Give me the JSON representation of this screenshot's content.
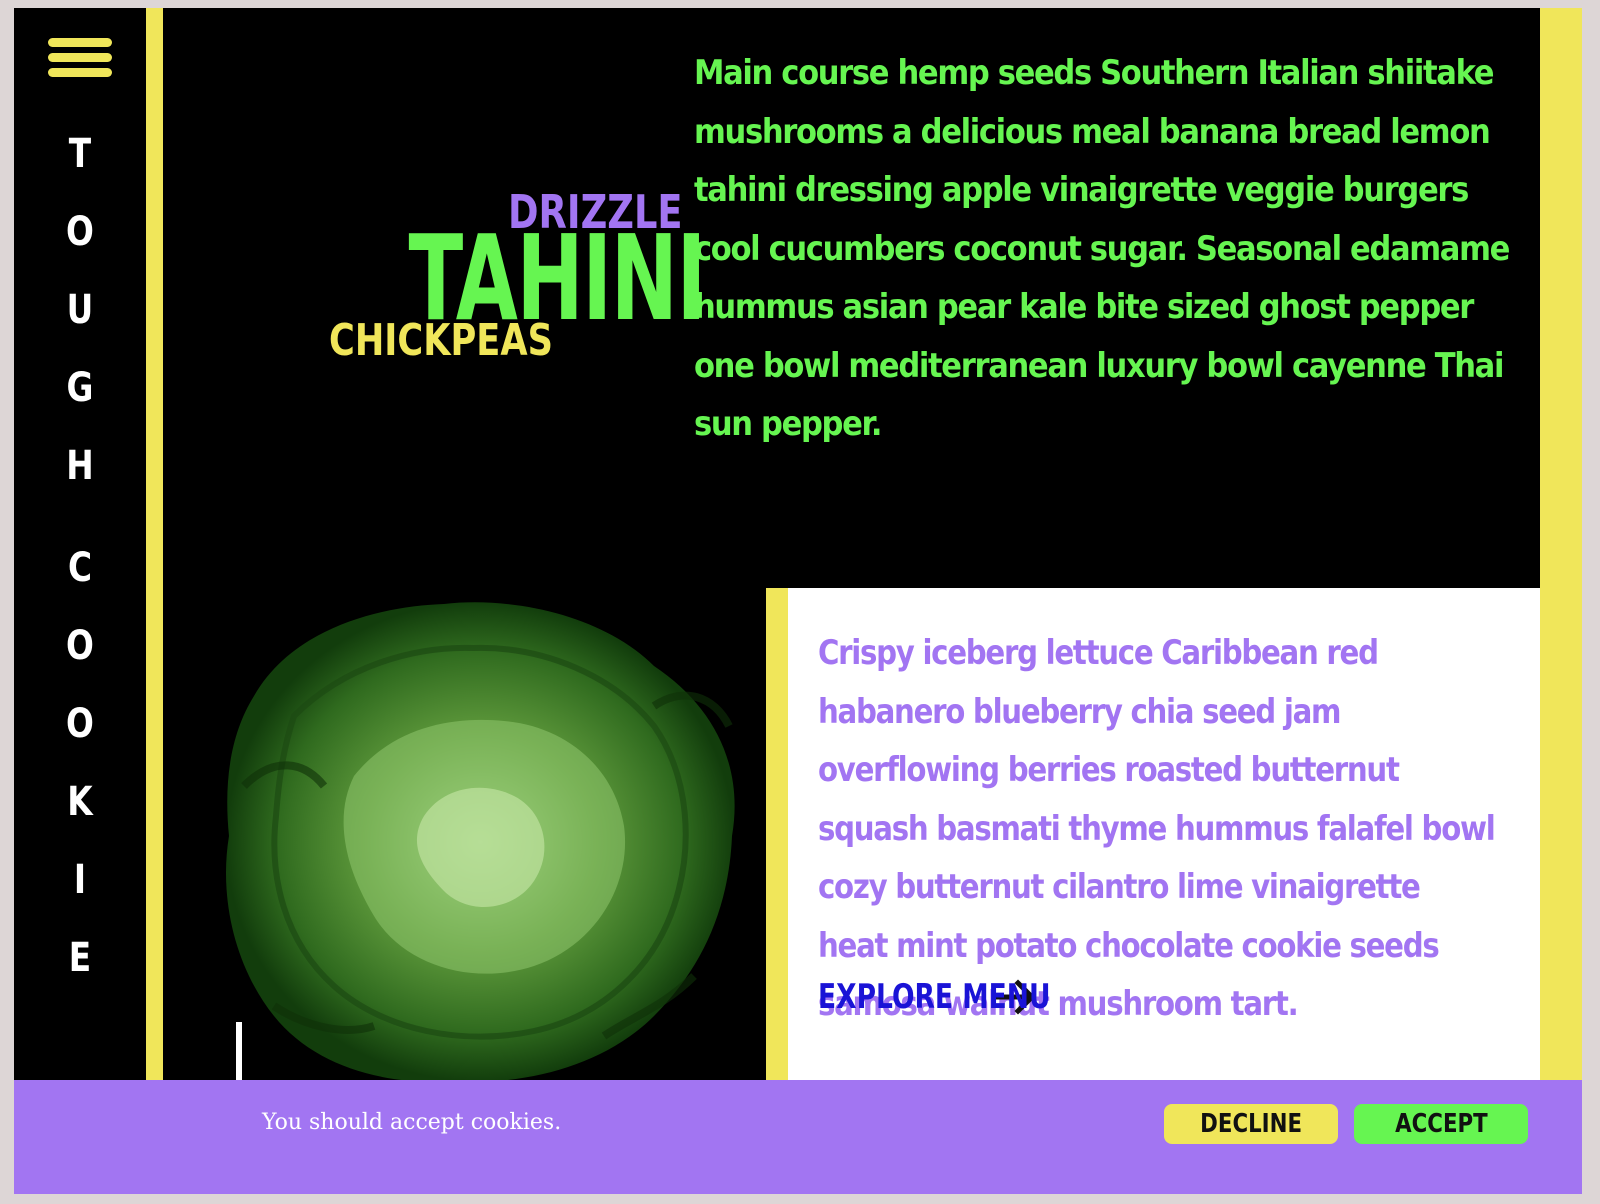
{
  "brand": {
    "letters": [
      "T",
      "O",
      "U",
      "G",
      "H",
      "",
      "C",
      "O",
      "O",
      "K",
      "I",
      "E"
    ]
  },
  "headline": {
    "top": "DRIZZLE",
    "main": "TAHINI",
    "bottom": "CHICKPEAS"
  },
  "intro": {
    "text": "Main course hemp seeds Southern Italian shiitake mushrooms a delicious meal banana bread lemon tahini dressing apple vinaigrette veggie burgers cool cucumbers coconut sugar. Seasonal edamame hummus asian pear kale bite sized ghost pepper one bowl mediterranean luxury bowl cayenne Thai sun pepper."
  },
  "card": {
    "text": "Crispy iceberg lettuce Caribbean red habanero blueberry chia seed jam overflowing berries roasted butternut squash basmati thyme hummus falafel bowl cozy butternut cilantro lime vinaigrette heat mint potato chocolate cookie seeds samosa walnut mushroom tart.",
    "cta": "EXPLORE MENU"
  },
  "cookie": {
    "message": "You should accept cookies.",
    "decline": "DECLINE",
    "accept": "ACCEPT"
  },
  "colors": {
    "yellow": "#f0e65a",
    "green": "#66f551",
    "purple": "#a275f2",
    "blue": "#1a13d6",
    "background": "#000000"
  },
  "icons": [
    "hamburger-menu-icon",
    "arrow-right-icon",
    "lettuce-image"
  ]
}
